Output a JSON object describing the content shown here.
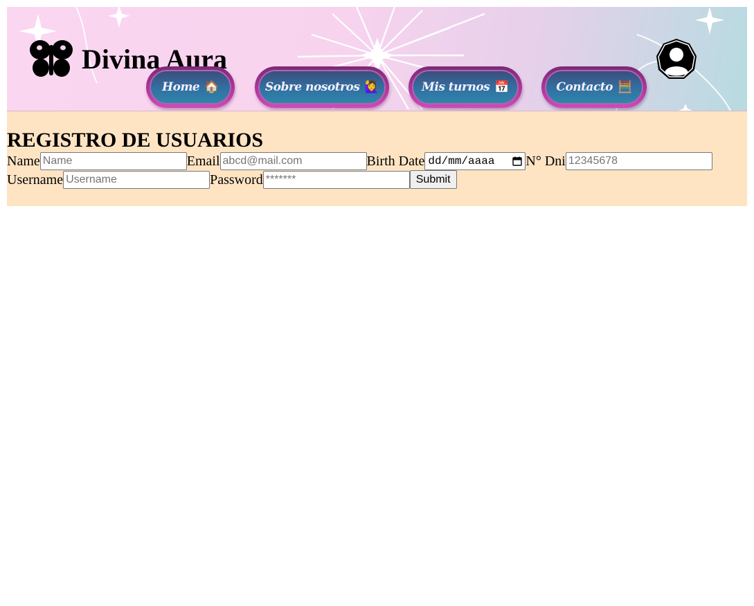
{
  "brand": {
    "name": "Divina Aura",
    "logo_icon": "butterfly-icon"
  },
  "nav": {
    "items": [
      {
        "label": "Home",
        "icon": "🏠",
        "icon_name": "house-icon"
      },
      {
        "label": "Sobre nosotros",
        "icon": "🙋‍♀️",
        "icon_name": "woman-raising-hand-icon"
      },
      {
        "label": "Mis turnos",
        "icon": "📅",
        "icon_name": "calendar-icon"
      },
      {
        "label": "Contacto",
        "icon": "🧮",
        "icon_name": "abacus-icon"
      }
    ],
    "profile_icon": "user-avatar-icon"
  },
  "form": {
    "title": "REGISTRO DE USUARIOS",
    "name_label": "Name",
    "name_placeholder": "Name",
    "email_label": "Email",
    "email_placeholder": "abcd@mail.com",
    "birth_label": "Birth Date",
    "birth_value": "dd/mm/aaaa",
    "dni_label": "N° Dni",
    "dni_placeholder": "12345678",
    "username_label": "Username",
    "username_placeholder": "Username",
    "password_label": "Password",
    "password_placeholder": "*******",
    "submit_label": "Submit"
  },
  "colors": {
    "form_background": "#ffe4c4",
    "nav_outer": "#b2389f",
    "nav_inner": "#3270a3",
    "header_gradient_start": "#fbd6f1",
    "header_gradient_end": "#b7dbe1"
  }
}
